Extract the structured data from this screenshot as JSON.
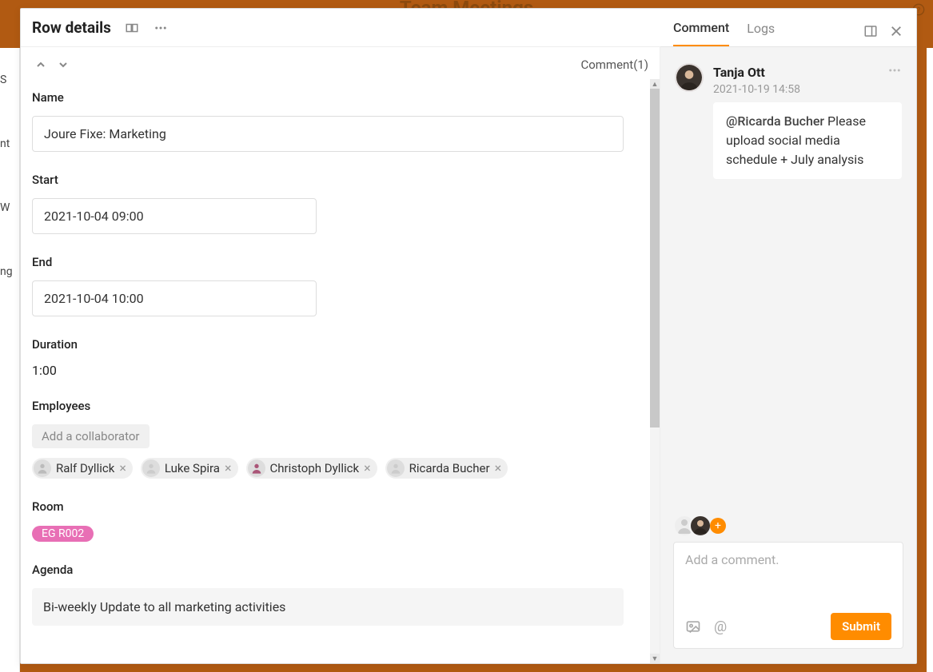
{
  "background": {
    "title": "Team Meetings",
    "left_rows": [
      "S",
      "nt",
      "W",
      "ng"
    ]
  },
  "modal": {
    "title": "Row details",
    "comment_link": "Comment(1)"
  },
  "fields": {
    "name_label": "Name",
    "name_value": "Joure Fixe: Marketing",
    "start_label": "Start",
    "start_value": "2021-10-04 09:00",
    "end_label": "End",
    "end_value": "2021-10-04 10:00",
    "duration_label": "Duration",
    "duration_value": "1:00",
    "employees_label": "Employees",
    "add_collab": "Add a collaborator",
    "employees": [
      {
        "name": "Ralf Dyllick"
      },
      {
        "name": "Luke Spira"
      },
      {
        "name": "Christoph Dyllick"
      },
      {
        "name": "Ricarda Bucher"
      }
    ],
    "room_label": "Room",
    "room_value": "EG R002",
    "agenda_label": "Agenda",
    "agenda_value": "Bi-weekly Update to all marketing activities"
  },
  "side": {
    "tab_comment": "Comment",
    "tab_logs": "Logs",
    "comment": {
      "author": "Tanja Ott",
      "time": "2021-10-19 14:58",
      "mention": "@Ricarda Bucher",
      "text_rest": " Please upload social media schedule + July analysis"
    },
    "compose_placeholder": "Add a comment.",
    "submit": "Submit"
  }
}
